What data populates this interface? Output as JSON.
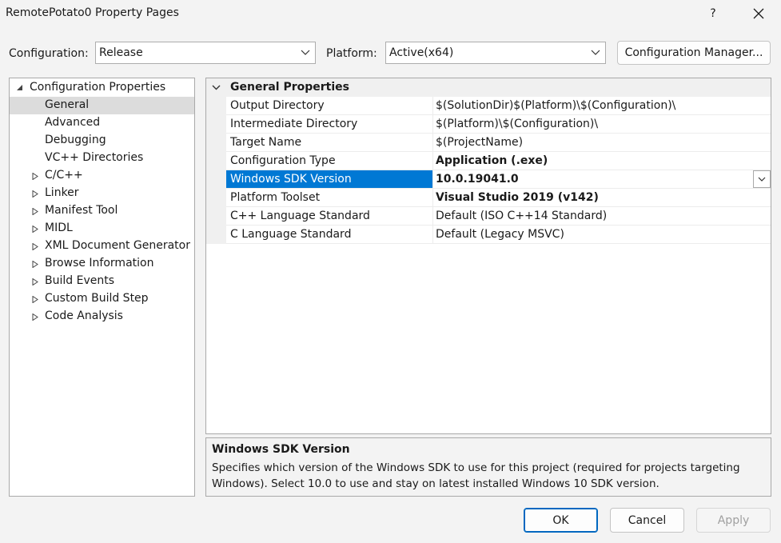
{
  "window": {
    "title": "RemotePotato0 Property Pages",
    "help_label": "?",
    "close_icon": "close-icon"
  },
  "toolbar": {
    "configuration_label": "Configuration:",
    "configuration_value": "Release",
    "platform_label": "Platform:",
    "platform_value": "Active(x64)",
    "config_manager_label": "Configuration Manager..."
  },
  "tree": {
    "root": "Configuration Properties",
    "items": [
      {
        "label": "General",
        "selected": true,
        "expandable": false
      },
      {
        "label": "Advanced",
        "expandable": false
      },
      {
        "label": "Debugging",
        "expandable": false
      },
      {
        "label": "VC++ Directories",
        "expandable": false
      },
      {
        "label": "C/C++",
        "expandable": true
      },
      {
        "label": "Linker",
        "expandable": true
      },
      {
        "label": "Manifest Tool",
        "expandable": true
      },
      {
        "label": "MIDL",
        "expandable": true
      },
      {
        "label": "XML Document Generator",
        "expandable": true
      },
      {
        "label": "Browse Information",
        "expandable": true
      },
      {
        "label": "Build Events",
        "expandable": true
      },
      {
        "label": "Custom Build Step",
        "expandable": true
      },
      {
        "label": "Code Analysis",
        "expandable": true
      }
    ]
  },
  "grid": {
    "category": "General Properties",
    "rows": [
      {
        "name": "Output Directory",
        "value": "$(SolutionDir)$(Platform)\\$(Configuration)\\",
        "bold": false
      },
      {
        "name": "Intermediate Directory",
        "value": "$(Platform)\\$(Configuration)\\",
        "bold": false
      },
      {
        "name": "Target Name",
        "value": "$(ProjectName)",
        "bold": false
      },
      {
        "name": "Configuration Type",
        "value": "Application (.exe)",
        "bold": true
      },
      {
        "name": "Windows SDK Version",
        "value": "10.0.19041.0",
        "bold": true,
        "selected": true
      },
      {
        "name": "Platform Toolset",
        "value": "Visual Studio 2019 (v142)",
        "bold": true
      },
      {
        "name": "C++ Language Standard",
        "value": "Default (ISO C++14 Standard)",
        "bold": false
      },
      {
        "name": "C Language Standard",
        "value": "Default (Legacy MSVC)",
        "bold": false
      }
    ]
  },
  "description": {
    "title": "Windows SDK Version",
    "text": "Specifies which version of the Windows SDK to use for this project (required for projects targeting Windows). Select 10.0 to use and stay on latest installed Windows 10 SDK version."
  },
  "buttons": {
    "ok": "OK",
    "cancel": "Cancel",
    "apply": "Apply"
  },
  "colors": {
    "selection": "#0078d4",
    "tree_selection": "#dcdcdc",
    "background": "#f3f3f3",
    "disabled_text": "#a0a0a0"
  }
}
